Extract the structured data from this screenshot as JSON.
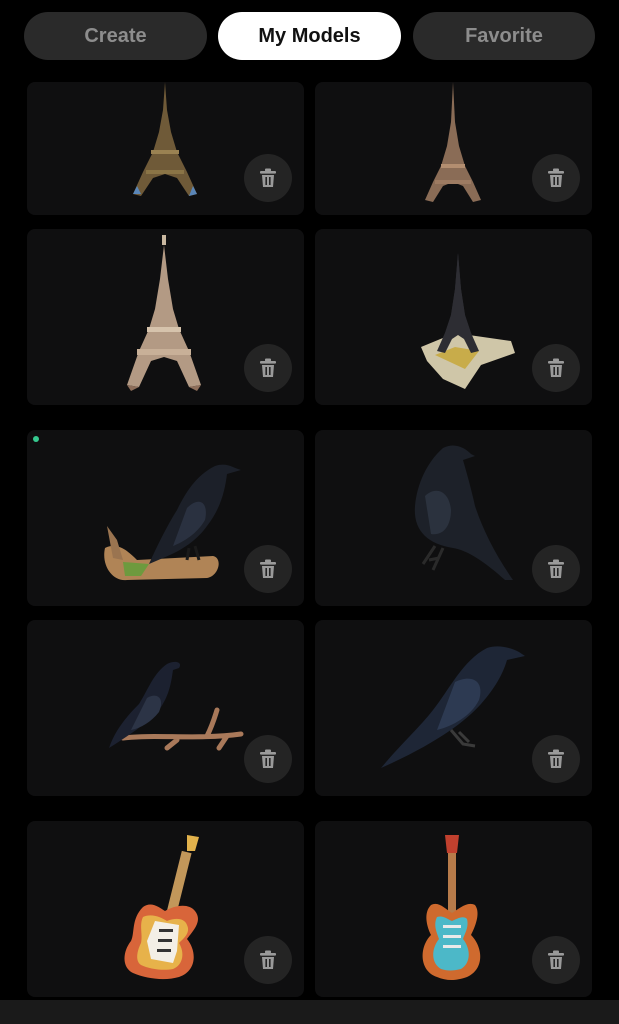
{
  "tabs": [
    {
      "label": "Create",
      "active": false
    },
    {
      "label": "My Models",
      "active": true
    },
    {
      "label": "Favorite",
      "active": false
    }
  ],
  "models": [
    {
      "subject": "eiffel-tower",
      "icon": "trash-icon"
    },
    {
      "subject": "eiffel-tower",
      "icon": "trash-icon"
    },
    {
      "subject": "eiffel-tower",
      "icon": "trash-icon"
    },
    {
      "subject": "eiffel-tower",
      "icon": "trash-icon"
    },
    {
      "subject": "raven",
      "icon": "trash-icon",
      "status_dot_color": "#36c98f"
    },
    {
      "subject": "raven",
      "icon": "trash-icon"
    },
    {
      "subject": "raven",
      "icon": "trash-icon"
    },
    {
      "subject": "raven",
      "icon": "trash-icon"
    },
    {
      "subject": "electric-guitar",
      "icon": "trash-icon"
    },
    {
      "subject": "electric-guitar",
      "icon": "trash-icon"
    }
  ],
  "colors": {
    "background": "#000000",
    "card": "#0f0f10",
    "tab_active": "#ffffff",
    "tab_inactive": "#2a2a2a",
    "status_dot": "#36c98f"
  }
}
